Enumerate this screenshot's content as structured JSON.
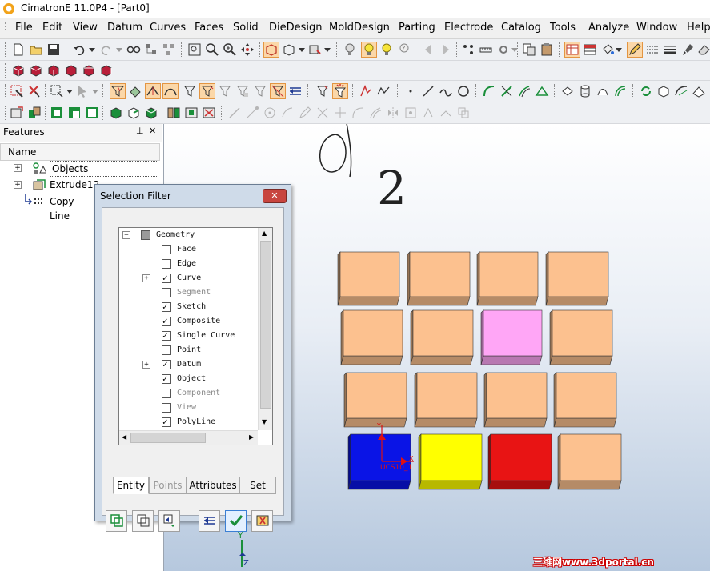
{
  "window": {
    "title": "CimatronE 11.0P4 - [Part0]"
  },
  "menu": [
    "File",
    "Edit",
    "View",
    "Datum",
    "Curves",
    "Faces",
    "Solid",
    "DieDesign",
    "MoldDesign",
    "Parting",
    "Electrode",
    "Catalog",
    "Tools",
    "Analyze",
    "Window",
    "Help"
  ],
  "features_panel": {
    "title": "Features",
    "pin_glyph": "⊥",
    "close_glyph": "✕",
    "column_header": "Name",
    "items": [
      {
        "label": "Objects",
        "icon": "objects-icon"
      },
      {
        "label": "Extrude12",
        "icon": "extrude-icon"
      },
      {
        "label": "Copy Line",
        "icon": "copy-line-icon"
      }
    ]
  },
  "selection_filter": {
    "title": "Selection Filter",
    "close_glyph": "✕",
    "root": {
      "label": "Geometry",
      "state": "partial"
    },
    "items": [
      {
        "label": "Face",
        "checked": false,
        "dim": false,
        "expander": false
      },
      {
        "label": "Edge",
        "checked": false,
        "dim": false,
        "expander": false
      },
      {
        "label": "Curve",
        "checked": true,
        "dim": false,
        "expander": true
      },
      {
        "label": "Segment",
        "checked": false,
        "dim": true,
        "expander": false
      },
      {
        "label": "Sketch",
        "checked": true,
        "dim": false,
        "expander": false
      },
      {
        "label": "Composite",
        "checked": true,
        "dim": false,
        "expander": false
      },
      {
        "label": "Single Curve",
        "checked": true,
        "dim": false,
        "expander": false
      },
      {
        "label": "Point",
        "checked": false,
        "dim": false,
        "expander": false
      },
      {
        "label": "Datum",
        "checked": true,
        "dim": false,
        "expander": true
      },
      {
        "label": "Object",
        "checked": true,
        "dim": false,
        "expander": false
      },
      {
        "label": "Component",
        "checked": false,
        "dim": true,
        "expander": false
      },
      {
        "label": "View",
        "checked": false,
        "dim": true,
        "expander": false
      },
      {
        "label": "PolyLine",
        "checked": true,
        "dim": false,
        "expander": false
      }
    ],
    "tabs": [
      {
        "label": "Entity",
        "active": true,
        "enabled": true
      },
      {
        "label": "Points",
        "active": false,
        "enabled": false
      },
      {
        "label": "Attributes",
        "active": false,
        "enabled": true
      },
      {
        "label": "Set",
        "active": false,
        "enabled": true
      }
    ],
    "buttons": [
      "select-all-icon",
      "invert-selection-icon",
      "swap-filter-icon",
      "previous-filter-icon",
      "ok-check-icon",
      "cancel-filter-icon"
    ]
  },
  "viewport": {
    "annotation_digit": "2",
    "ucs_label": "UCS10_1",
    "axis_labels": {
      "x": "X",
      "y": "Y",
      "z": "Z"
    },
    "box_colors": [
      "#fcc18f",
      "#fcc18f",
      "#fcc18f",
      "#fcc18f",
      "#fcc18f",
      "#fcc18f",
      "#ffa6f6",
      "#fcc18f",
      "#fcc18f",
      "#fcc18f",
      "#fcc18f",
      "#fcc18f",
      "#0a14e6",
      "#ffff00",
      "#e81414",
      "#fcc18f"
    ]
  },
  "watermark": "三维网www.3dportal.cn",
  "colors": {
    "accent_orange": "#f5b37a",
    "highlight_box": "#ffa6f6",
    "titlebar_close": "#c8453f"
  }
}
